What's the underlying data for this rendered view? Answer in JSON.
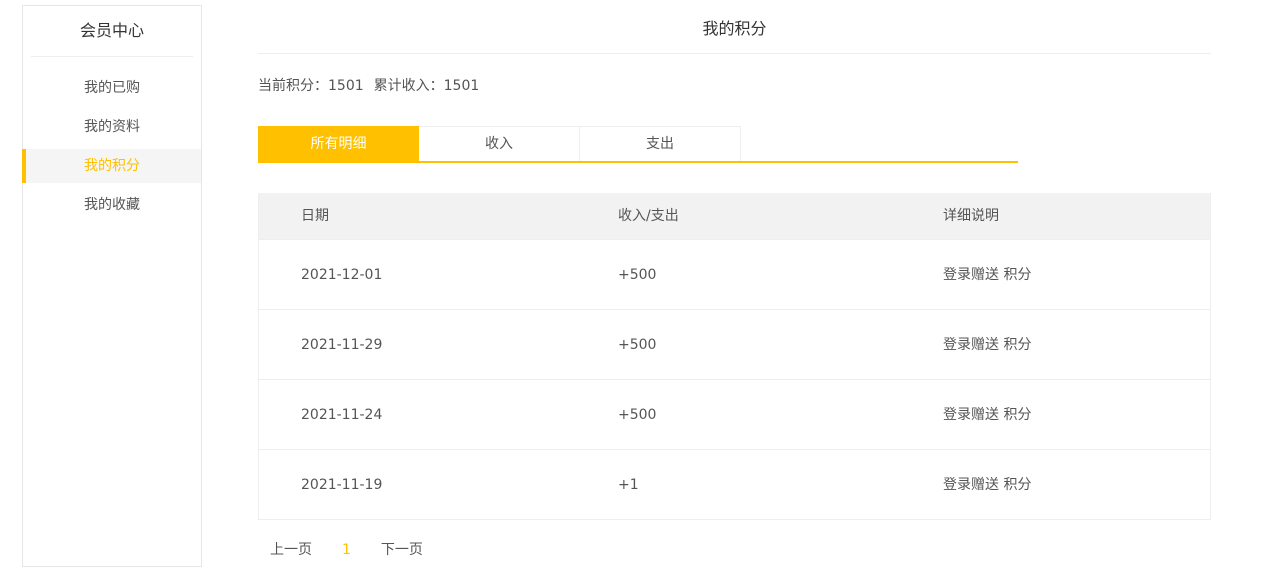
{
  "sidebar": {
    "title": "会员中心",
    "items": [
      {
        "label": "我的已购",
        "active": false
      },
      {
        "label": "我的资料",
        "active": false
      },
      {
        "label": "我的积分",
        "active": true
      },
      {
        "label": "我的收藏",
        "active": false
      }
    ]
  },
  "page": {
    "title": "我的积分"
  },
  "summary": {
    "points_label": "当前积分：",
    "points_value": "1501",
    "income_label": "累计收入：",
    "income_value": "1501"
  },
  "tabs": [
    {
      "label": "所有明细",
      "active": true
    },
    {
      "label": "收入",
      "active": false
    },
    {
      "label": "支出",
      "active": false
    }
  ],
  "table": {
    "headers": [
      "日期",
      "收入/支出",
      "详细说明"
    ],
    "rows": [
      {
        "date": "2021-12-01",
        "amount": "+500",
        "desc": "登录赠送 积分"
      },
      {
        "date": "2021-11-29",
        "amount": "+500",
        "desc": "登录赠送 积分"
      },
      {
        "date": "2021-11-24",
        "amount": "+500",
        "desc": "登录赠送 积分"
      },
      {
        "date": "2021-11-19",
        "amount": "+1",
        "desc": "登录赠送 积分"
      }
    ]
  },
  "pagination": {
    "prev": "上一页",
    "current": "1",
    "next": "下一页"
  },
  "colors": {
    "accent": "#ffc000",
    "header_bg": "#f2f2f2",
    "text": "#555555",
    "border": "#eeeeee"
  }
}
